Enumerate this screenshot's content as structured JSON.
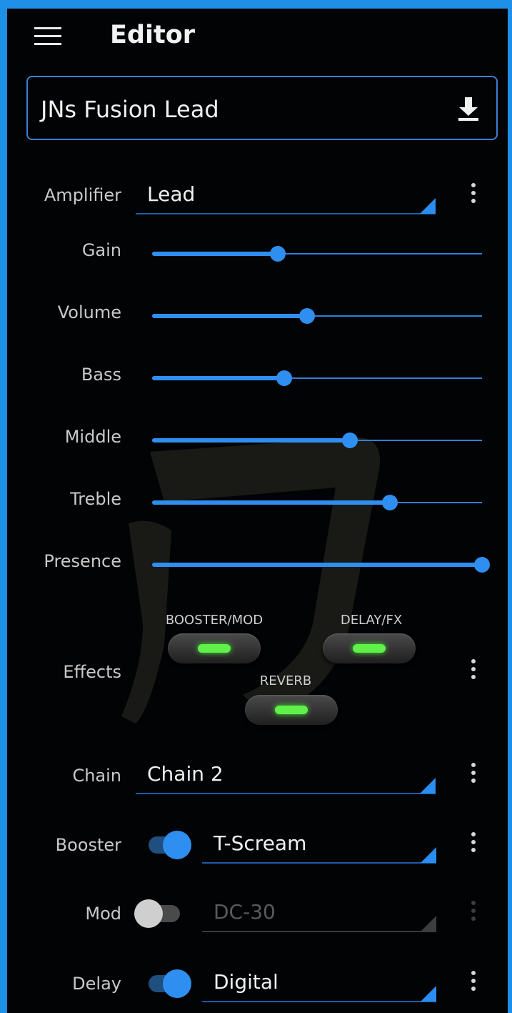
{
  "header": {
    "title": "Editor",
    "menu_icon": "hamburger-menu-icon"
  },
  "preset": {
    "name": "JNs Fusion Lead",
    "download_icon": "download-icon"
  },
  "amplifier": {
    "label": "Amplifier",
    "value": "Lead"
  },
  "controls": [
    {
      "label": "Gain",
      "level": 0.38
    },
    {
      "label": "Volume",
      "level": 0.47
    },
    {
      "label": "Bass",
      "level": 0.4
    },
    {
      "label": "Middle",
      "level": 0.6
    },
    {
      "label": "Treble",
      "level": 0.72
    },
    {
      "label": "Presence",
      "level": 1.0
    }
  ],
  "effects": {
    "label": "Effects",
    "buttons": [
      {
        "label": "BOOSTER/MOD",
        "on": true
      },
      {
        "label": "DELAY/FX",
        "on": true
      },
      {
        "label": "REVERB",
        "on": true
      }
    ]
  },
  "chain": {
    "label": "Chain",
    "value": "Chain 2"
  },
  "booster": {
    "label": "Booster",
    "value": "T-Scream",
    "enabled": true
  },
  "mod": {
    "label": "Mod",
    "value": "DC-30",
    "enabled": false
  },
  "delay": {
    "label": "Delay",
    "value": "Digital",
    "enabled": true
  },
  "colors": {
    "accent": "#2f8ff0",
    "background": "#020305",
    "frame": "#1e90e8",
    "led": "#5ff04a"
  }
}
